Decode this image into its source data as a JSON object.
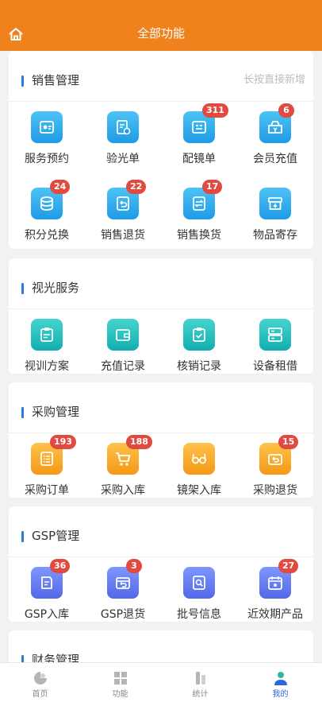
{
  "header": {
    "title": "全部功能",
    "home_icon": "home-icon"
  },
  "sections": [
    {
      "title": "销售管理",
      "hint": "长按直接新增",
      "items": [
        {
          "label": "服务预约",
          "icon": "appointment-icon",
          "badge": ""
        },
        {
          "label": "验光单",
          "icon": "optometry-icon",
          "badge": ""
        },
        {
          "label": "配镜单",
          "icon": "glasses-order-icon",
          "badge": "311"
        },
        {
          "label": "会员充值",
          "icon": "member-recharge-icon",
          "badge": "6"
        },
        {
          "label": "积分兑换",
          "icon": "points-icon",
          "badge": "24"
        },
        {
          "label": "销售退货",
          "icon": "sales-return-icon",
          "badge": "22"
        },
        {
          "label": "销售换货",
          "icon": "sales-exchange-icon",
          "badge": "17"
        },
        {
          "label": "物品寄存",
          "icon": "storage-icon",
          "badge": ""
        }
      ]
    },
    {
      "title": "视光服务",
      "hint": "",
      "items": [
        {
          "label": "视训方案",
          "icon": "training-plan-icon",
          "badge": ""
        },
        {
          "label": "充值记录",
          "icon": "wallet-icon",
          "badge": ""
        },
        {
          "label": "核销记录",
          "icon": "verify-icon",
          "badge": ""
        },
        {
          "label": "设备租借",
          "icon": "device-rent-icon",
          "badge": ""
        }
      ]
    },
    {
      "title": "采购管理",
      "hint": "",
      "items": [
        {
          "label": "采购订单",
          "icon": "purchase-order-icon",
          "badge": "193"
        },
        {
          "label": "采购入库",
          "icon": "cart-in-icon",
          "badge": "188"
        },
        {
          "label": "镜架入库",
          "icon": "frame-in-icon",
          "badge": ""
        },
        {
          "label": "采购退货",
          "icon": "purchase-return-icon",
          "badge": "15"
        }
      ]
    },
    {
      "title": "GSP管理",
      "hint": "",
      "items": [
        {
          "label": "GSP入库",
          "icon": "gsp-in-icon",
          "badge": "36"
        },
        {
          "label": "GSP退货",
          "icon": "gsp-return-icon",
          "badge": "3"
        },
        {
          "label": "批号信息",
          "icon": "batch-info-icon",
          "badge": ""
        },
        {
          "label": "近效期产品",
          "icon": "expiry-icon",
          "badge": "27"
        }
      ]
    },
    {
      "title": "财务管理",
      "hint": "",
      "items": []
    }
  ],
  "tabbar": [
    {
      "label": "首页",
      "icon": "home-tab-icon"
    },
    {
      "label": "功能",
      "icon": "functions-tab-icon"
    },
    {
      "label": "统计",
      "icon": "stats-tab-icon"
    },
    {
      "label": "我的",
      "icon": "profile-tab-icon"
    }
  ],
  "colors": {
    "header": "#f0821e",
    "accent": "#2a7fd4",
    "badge": "#e04a3f",
    "active_tab": "#2a6ad8"
  }
}
